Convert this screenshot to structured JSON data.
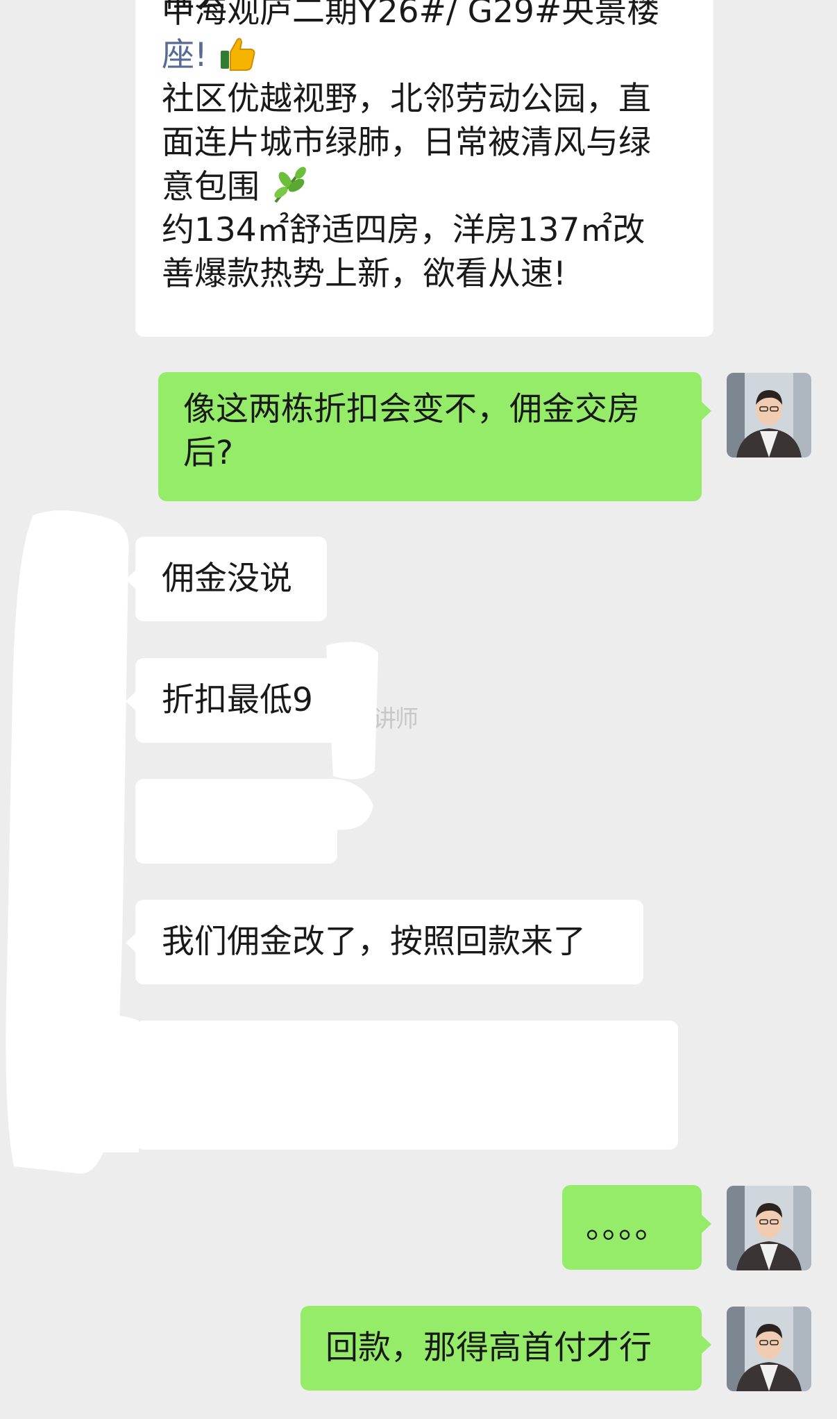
{
  "messages": [
    {
      "side": "incoming",
      "lines": [
        "社会",
        "中海观庐二期Y26#/ G29#央景楼",
        "座!",
        "社区优越视野，北邻劳动公园，直",
        "面连片城市绿肺，日常被清风与绿",
        "意包围",
        "约134㎡舒适四房，洋房137㎡改",
        "善爆款热势上新，欲看从速!"
      ],
      "emoji": [
        "thumbs-up",
        "herb"
      ]
    },
    {
      "side": "outgoing",
      "lines": [
        "像这两栋折扣会变不，佣金交房",
        "后?"
      ]
    },
    {
      "side": "incoming",
      "text": "佣金没说"
    },
    {
      "side": "incoming",
      "text": "折扣最低9"
    },
    {
      "side": "incoming",
      "text": "我们佣金改了，按照回款来了"
    },
    {
      "side": "outgoing",
      "text": "。。。。"
    },
    {
      "side": "outgoing",
      "text": "回款，那得高首付才行"
    }
  ],
  "faded_text": "，讲师",
  "icons": {
    "thumbs_up": "thumbs-up-emoji",
    "herb": "herb-emoji"
  },
  "colors": {
    "background": "#ededed",
    "incoming_bubble": "#ffffff",
    "outgoing_bubble": "#95ec69",
    "tag": "#576b95"
  }
}
